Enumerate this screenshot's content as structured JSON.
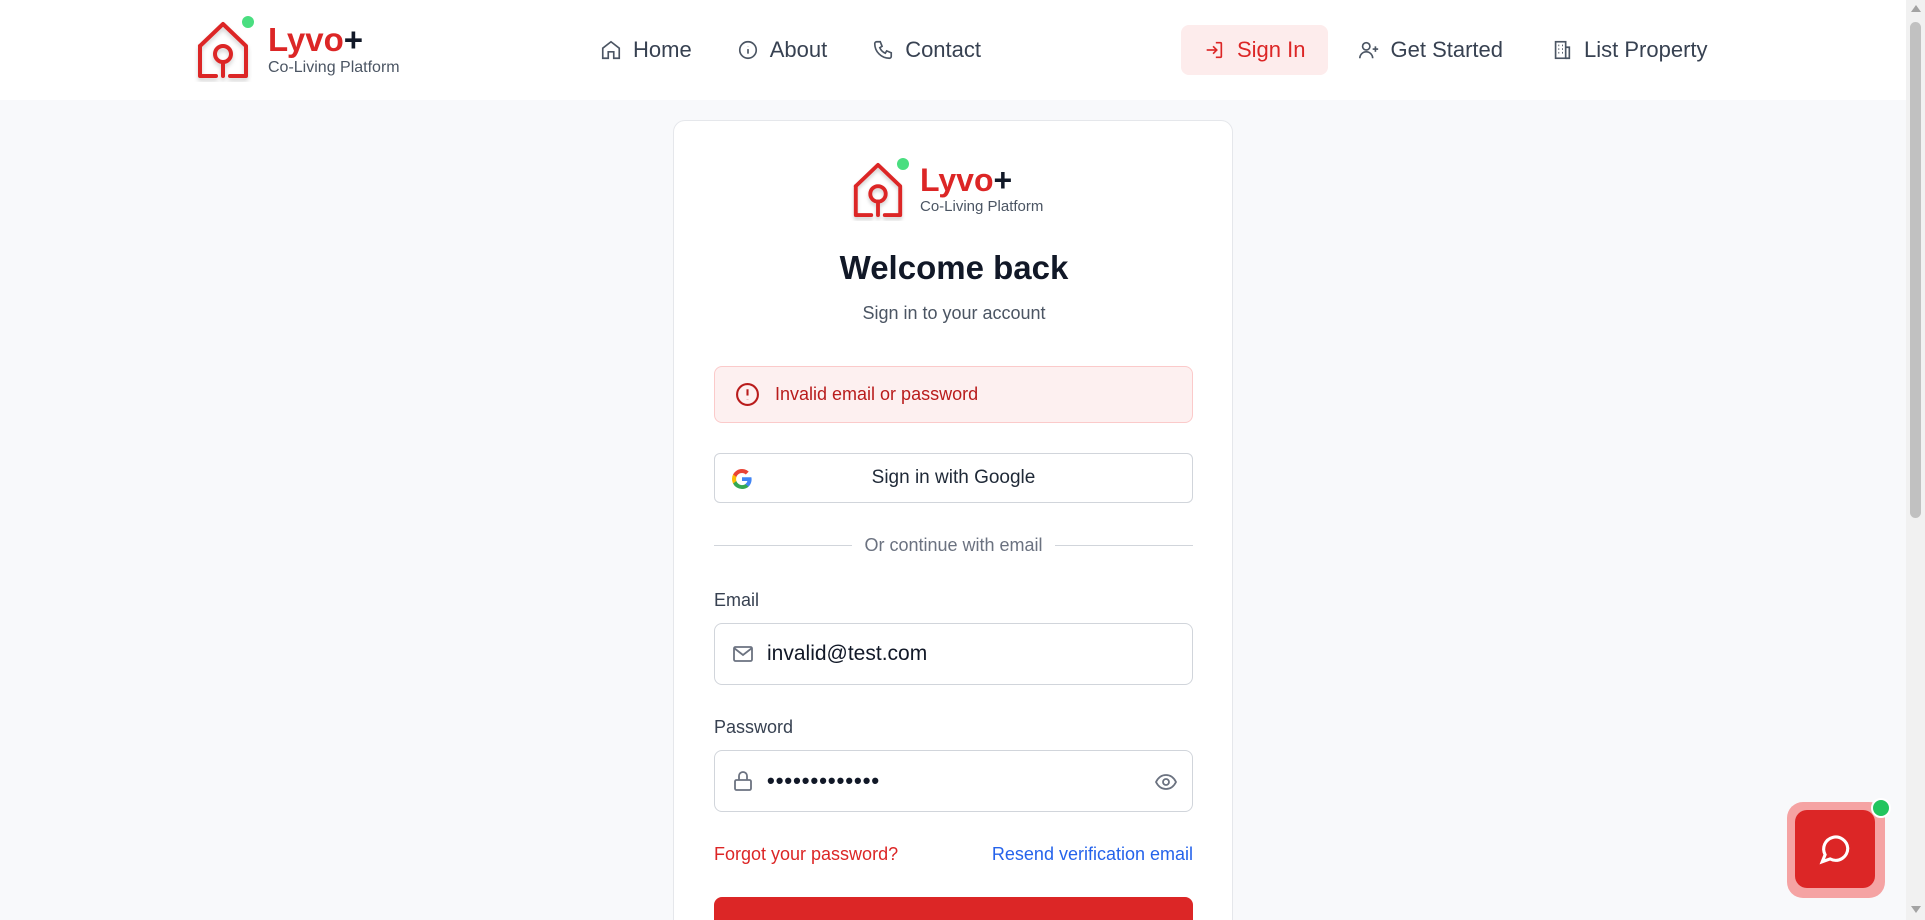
{
  "header": {
    "brand_name": "Lyvo",
    "brand_plus": "+",
    "brand_subtitle": "Co-Living Platform",
    "nav": [
      {
        "label": "Home",
        "icon": "home-icon"
      },
      {
        "label": "About",
        "icon": "info-icon"
      },
      {
        "label": "Contact",
        "icon": "phone-icon"
      }
    ],
    "sign_in_label": "Sign In",
    "get_started_label": "Get Started",
    "list_property_label": "List Property"
  },
  "card": {
    "brand_name": "Lyvo",
    "brand_plus": "+",
    "brand_subtitle": "Co-Living Platform",
    "title": "Welcome back",
    "subtitle": "Sign in to your account",
    "error_message": "Invalid email or password",
    "google_label": "Sign in with Google",
    "divider_text": "Or continue with email",
    "email_label": "Email",
    "email_value": "invalid@test.com",
    "password_label": "Password",
    "password_value": "•••••••••••••",
    "forgot_label": "Forgot your password?",
    "resend_label": "Resend verification email"
  },
  "colors": {
    "brand_red": "#dc2626",
    "link_blue": "#2563eb",
    "online_green": "#4ade80"
  }
}
